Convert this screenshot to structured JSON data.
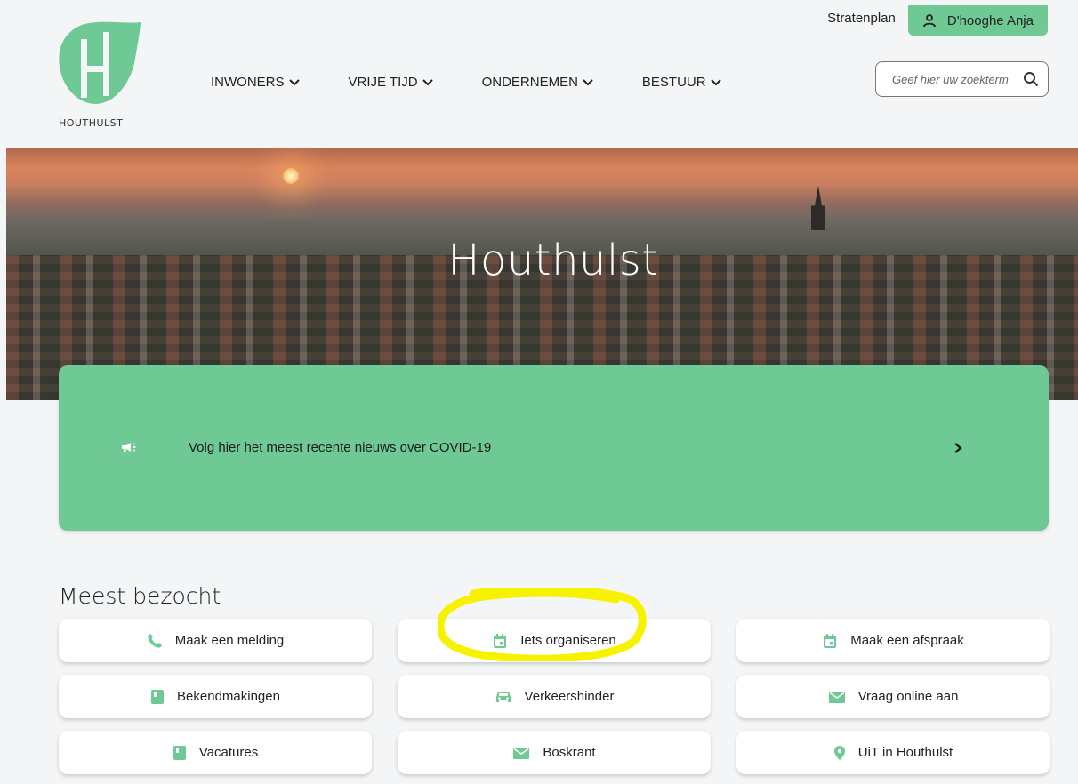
{
  "header": {
    "logo_text": "HOUTHULST",
    "nav": [
      {
        "label": "INWONERS"
      },
      {
        "label": "VRIJE TIJD"
      },
      {
        "label": "ONDERNEMEN"
      },
      {
        "label": "BESTUUR"
      }
    ],
    "stratenplan_label": "Stratenplan",
    "user_label": "D'hooghe Anja",
    "search_placeholder": "Geef hier uw zoekterm"
  },
  "hero": {
    "title": "Houthulst"
  },
  "banner": {
    "text": "Volg hier het meest recente nieuws over COVID-19",
    "icon": "megaphone-icon"
  },
  "most_visited": {
    "title": "Meest bezocht",
    "tiles": [
      {
        "label": "Maak een melding",
        "icon": "phone-icon"
      },
      {
        "label": "Iets organiseren",
        "icon": "calendar-icon"
      },
      {
        "label": "Maak een afspraak",
        "icon": "calendar-icon"
      },
      {
        "label": "Bekendmakingen",
        "icon": "book-icon"
      },
      {
        "label": "Verkeershinder",
        "icon": "car-icon"
      },
      {
        "label": "Vraag online aan",
        "icon": "mail-icon"
      },
      {
        "label": "Vacatures",
        "icon": "book-icon"
      },
      {
        "label": "Boskrant",
        "icon": "mail-icon"
      },
      {
        "label": "UiT in Houthulst",
        "icon": "location-pin-icon"
      }
    ]
  },
  "colors": {
    "accent_green": "#6fc995",
    "highlight_yellow": "#f7f200"
  }
}
